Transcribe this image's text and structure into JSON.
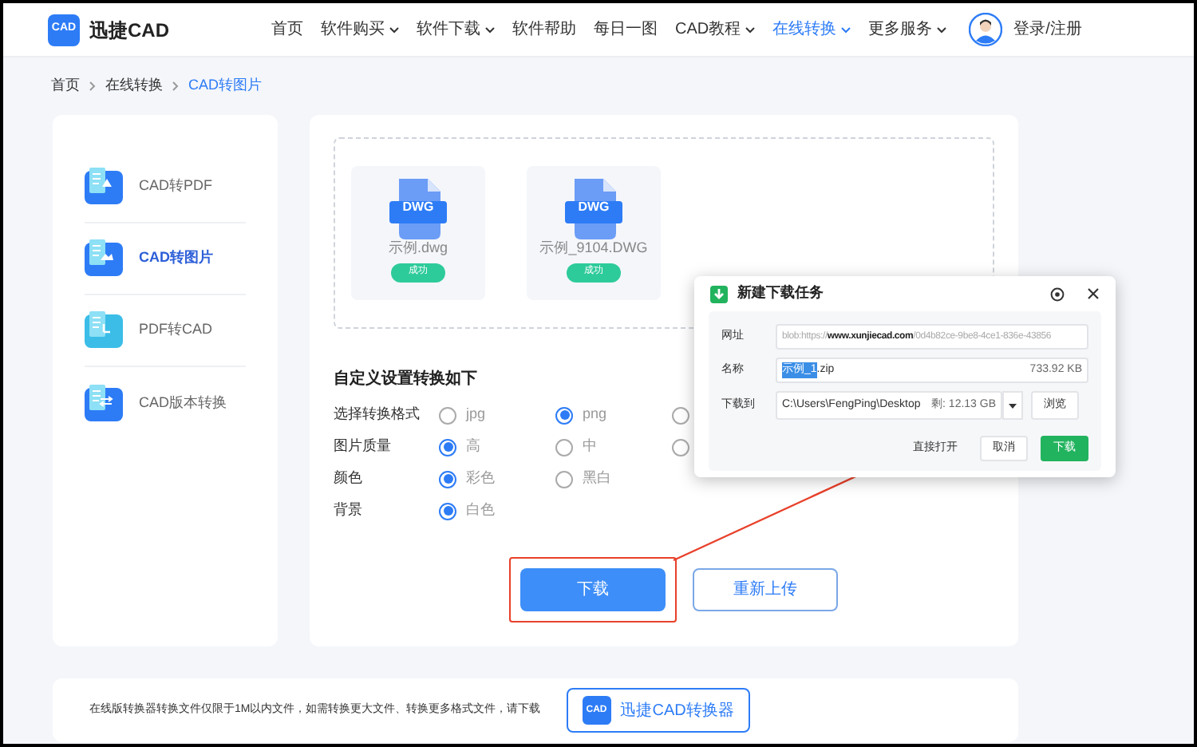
{
  "nav": {
    "logo_badge": "CAD",
    "logo_text": "迅捷CAD",
    "items": [
      {
        "label": "首页",
        "dropdown": false,
        "selected": false
      },
      {
        "label": "软件购买",
        "dropdown": true,
        "selected": false
      },
      {
        "label": "软件下载",
        "dropdown": true,
        "selected": false
      },
      {
        "label": "软件帮助",
        "dropdown": false,
        "selected": false
      },
      {
        "label": "每日一图",
        "dropdown": false,
        "selected": false
      },
      {
        "label": "CAD教程",
        "dropdown": true,
        "selected": false
      },
      {
        "label": "在线转换",
        "dropdown": true,
        "selected": true
      },
      {
        "label": "更多服务",
        "dropdown": true,
        "selected": false
      }
    ],
    "login": "登录/注册"
  },
  "breadcrumb": [
    {
      "label": "首页",
      "current": false
    },
    {
      "label": "在线转换",
      "current": false
    },
    {
      "label": "CAD转图片",
      "current": true
    }
  ],
  "sidebar": {
    "items": [
      {
        "label": "CAD转PDF",
        "selected": false
      },
      {
        "label": "CAD转图片",
        "selected": true
      },
      {
        "label": "PDF转CAD",
        "selected": false
      },
      {
        "label": "CAD版本转换",
        "selected": false
      }
    ]
  },
  "upload": {
    "files": [
      {
        "badge": "DWG",
        "name": "示例.dwg",
        "status": "成功"
      },
      {
        "badge": "DWG",
        "name": "示例_9104.DWG",
        "status": "成功"
      }
    ]
  },
  "settings": {
    "title": "自定义设置转换如下",
    "rows": [
      {
        "label": "选择转换格式",
        "options": [
          {
            "label": "jpg",
            "selected": false
          },
          {
            "label": "png",
            "selected": true
          },
          {
            "selected": false
          }
        ]
      },
      {
        "label": "图片质量",
        "options": [
          {
            "label": "高",
            "selected": true
          },
          {
            "label": "中",
            "selected": false
          },
          {
            "selected": false
          }
        ]
      },
      {
        "label": "颜色",
        "options": [
          {
            "label": "彩色",
            "selected": true
          },
          {
            "label": "黑白",
            "selected": false
          }
        ]
      },
      {
        "label": "背景",
        "options": [
          {
            "label": "白色",
            "selected": true
          }
        ]
      }
    ]
  },
  "actions": [
    {
      "label": "下载",
      "kind": "primary",
      "highlighted": true
    },
    {
      "label": "重新上传",
      "kind": "outline",
      "highlighted": false
    }
  ],
  "footer": {
    "note": "在线版转换器转换文件仅限于1M以内文件，如需转换更大文件、转换更多格式文件，请下载",
    "button_badge": "CAD",
    "button": "迅捷CAD转换器"
  },
  "dialog": {
    "title": "新建下载任务",
    "url_label": "网址",
    "url": "blob:https://**www.xunjiecad.com**/0d4b82ce-9be8-4ce1-836e-43856",
    "name_label": "名称",
    "name_selected": "示例_1",
    "name_rest": ".zip",
    "size": "733.92 KB",
    "path_label": "下载到",
    "path": "C:\\Users\\FengPing\\Desktop",
    "free": "剩: 12.13 GB",
    "browse": "浏览",
    "open": "直接打开",
    "cancel": "取消",
    "download": "下载"
  }
}
